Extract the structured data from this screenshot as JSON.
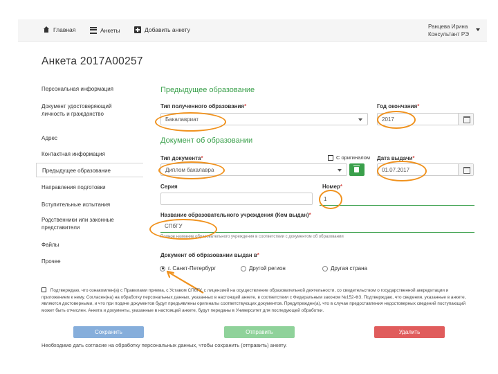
{
  "nav": {
    "home": "Главная",
    "forms": "Анкеты",
    "add": "Добавить анкету"
  },
  "user": {
    "name": "Ранцева Ирина",
    "role": "Консультант РЭ"
  },
  "page": {
    "title": "Анкета 2017А00257"
  },
  "sidebar": {
    "items": [
      {
        "label": "Персональная информация"
      },
      {
        "label": "Документ удостоверяющий личность и гражданство"
      },
      {
        "label": "Адрес"
      },
      {
        "label": "Контактная информация"
      },
      {
        "label": "Предыдущее образование"
      },
      {
        "label": "Направления подготовки"
      },
      {
        "label": "Вступительные испытания"
      },
      {
        "label": "Родственники или законные представители"
      },
      {
        "label": "Файлы"
      },
      {
        "label": "Прочее"
      }
    ]
  },
  "form": {
    "section_prev_edu": "Предыдущее образование",
    "edu_type_label": "Тип полученного образования",
    "edu_type_value": "Бакалавриат",
    "grad_year_label": "Год окончания",
    "grad_year_value": "2017",
    "section_doc": "Документ об образовании",
    "doc_type_label": "Тип документа",
    "doc_type_value": "Диплом бакалавра",
    "original_label": "С оригиналом",
    "issue_date_label": "Дата выдачи",
    "issue_date_value": "01.07.2017",
    "series_label": "Серия",
    "series_value": "",
    "number_label": "Номер",
    "number_value": "1",
    "institution_label": "Название образовательного учреждения (Кем выдан)",
    "institution_value": "СПбГУ",
    "institution_hint": "Полное название образовательного учреждения в соответствии с документом об образовании",
    "issued_in_label": "Документ об образовании выдан в",
    "radio_spb": "г. Санкт-Петербург",
    "radio_other_region": "Другой регион",
    "radio_other_country": "Другая страна",
    "required_mark": "*"
  },
  "consent": {
    "text": "Подтверждаю, что ознакомлен(а) с Правилами приема, с Уставом СПбГУ, с лицензией на осуществление образовательной деятельности, со свидетельством о государственной аккредитации и приложением к нему. Согласен(на) на обработку персональных данных, указанных в настоящей анкете, в соответствии с Федеральным законом №152-ФЗ. Подтверждаю, что сведения, указанные в анкете, являются достоверными, и что при подаче документов будут предъявлены оригиналы соответствующих документов. Предупрежден(а), что в случае предоставления недостоверных сведений поступающий может быть отчислен. Анкета и документы, указанные в настоящей анкете, будут переданы в Университет для последующей обработки."
  },
  "buttons": {
    "save": "Сохранить",
    "send": "Отправить",
    "delete": "Удалить"
  },
  "footnote": "Необходимо дать согласие на обработку персональных данных, чтобы сохранить (отправить) анкету.",
  "colors": {
    "accent_green": "#3aa04b",
    "annotation_orange": "#f0921e",
    "save_blue": "#86aedb",
    "send_green": "#8fd29a",
    "delete_red": "#e05c5c"
  }
}
